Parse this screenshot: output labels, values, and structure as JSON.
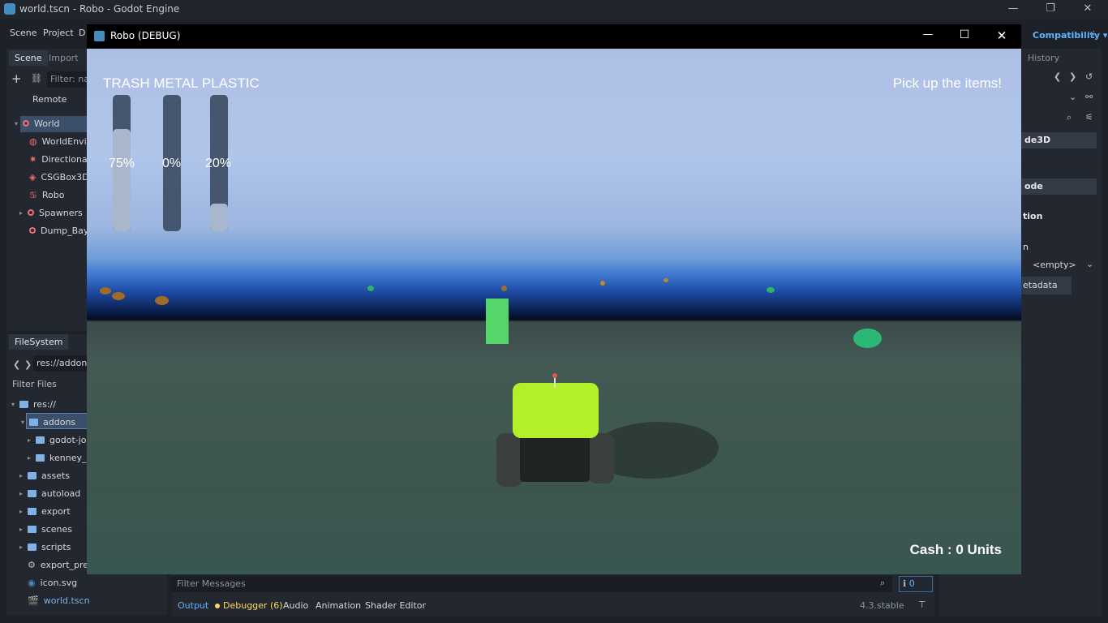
{
  "godot": {
    "window_title": "world.tscn - Robo - Godot Engine",
    "menu": [
      "Scene",
      "Project",
      "D"
    ],
    "renderer": "Compatibility",
    "right_tab": "History"
  },
  "scene_dock": {
    "tabs": [
      "Scene",
      "Import"
    ],
    "filter_placeholder": "Filter: nar",
    "remote_label": "Remote",
    "nodes": [
      "World",
      "WorldEnviro",
      "DirectionalL",
      "CSGBox3D",
      "Robo",
      "Spawners",
      "Dump_Bay"
    ]
  },
  "filesystem_dock": {
    "tab": "FileSystem",
    "path": "res://addons/",
    "filter_placeholder": "Filter Files",
    "items": [
      "res://",
      "addons",
      "godot-jolt",
      "kenney_p",
      "assets",
      "autoload",
      "export",
      "scenes",
      "scripts",
      "export_pres",
      "icon.svg",
      "world.tscn"
    ]
  },
  "inspector": {
    "node_type": "de3D",
    "section": "ode",
    "group": "tion",
    "group2": "n",
    "empty_value": "<empty>",
    "metadata_label": "etadata"
  },
  "bottom_panel": {
    "filter_placeholder": "Filter Messages",
    "count": "0",
    "tabs": [
      "Output",
      "Debugger (6)",
      "Audio",
      "Animation",
      "Shader Editor"
    ],
    "version": "4.3.stable"
  },
  "game": {
    "window_title": "Robo (DEBUG)",
    "hud": {
      "bins_label": "TRASH METAL PLASTIC",
      "bins": [
        {
          "name": "TRASH",
          "pct_text": "75%",
          "level": 0.75
        },
        {
          "name": "METAL",
          "pct_text": "0%",
          "level": 0.0
        },
        {
          "name": "PLASTIC",
          "pct_text": "20%",
          "level": 0.2
        }
      ],
      "objective": "Pick up the items!",
      "cash": "Cash : 0 Units"
    }
  },
  "colors": {
    "accent": "#5fb2ff",
    "node_icon": "#f26c73",
    "folder": "#7fb1e6",
    "robot_body": "#b4f02a"
  }
}
